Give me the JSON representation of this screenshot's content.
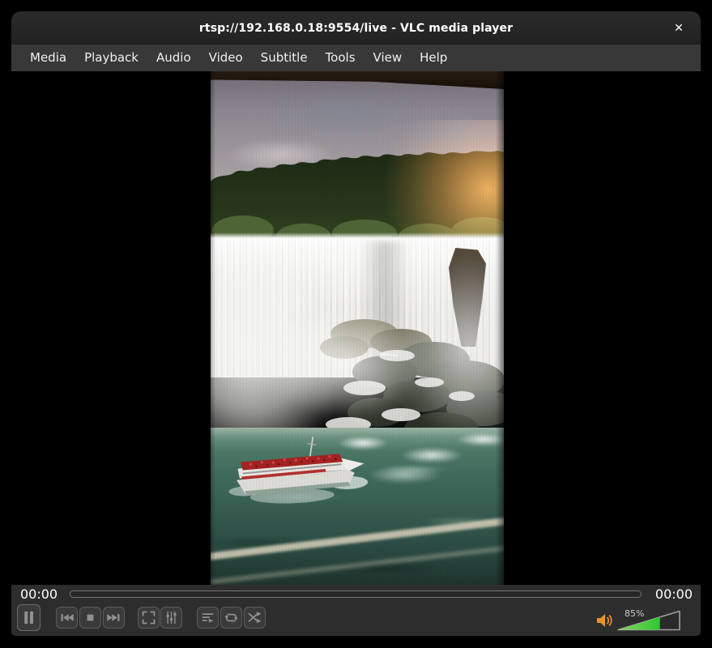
{
  "window": {
    "title": "rtsp://192.168.0.18:9554/live - VLC media player",
    "close_glyph": "✕"
  },
  "menu": {
    "items": [
      "Media",
      "Playback",
      "Audio",
      "Video",
      "Subtitle",
      "Tools",
      "View",
      "Help"
    ]
  },
  "transport": {
    "elapsed": "00:00",
    "remaining": "00:00",
    "buttons": [
      "pause",
      "previous",
      "stop",
      "next",
      "fullscreen",
      "extended-settings",
      "playlist",
      "loop",
      "random"
    ]
  },
  "volume": {
    "level_label": "85%",
    "fill_fraction": 0.68,
    "bar_color": "#35c92f",
    "icon_color": "#e8912f"
  },
  "theme": {
    "titlebar_bg": "#232323",
    "menubar_bg": "#383838",
    "controls_bg": "#2d2d2d",
    "button_bg": "#3a3a3a",
    "button_border": "#5c5c5c",
    "icon_color": "#909090",
    "text_color": "#ffffff"
  },
  "video_scene": {
    "subject": "waterfall with tour boat on river",
    "sky_color": "#9d969c",
    "tree_color": "#24331a",
    "falls_color": "#efeeea",
    "water_color": "#3f6a5c",
    "boat_hull_color": "#e8e7e3",
    "boat_passenger_color": "#a82626",
    "sun_glow_color": "#ee8e42"
  }
}
